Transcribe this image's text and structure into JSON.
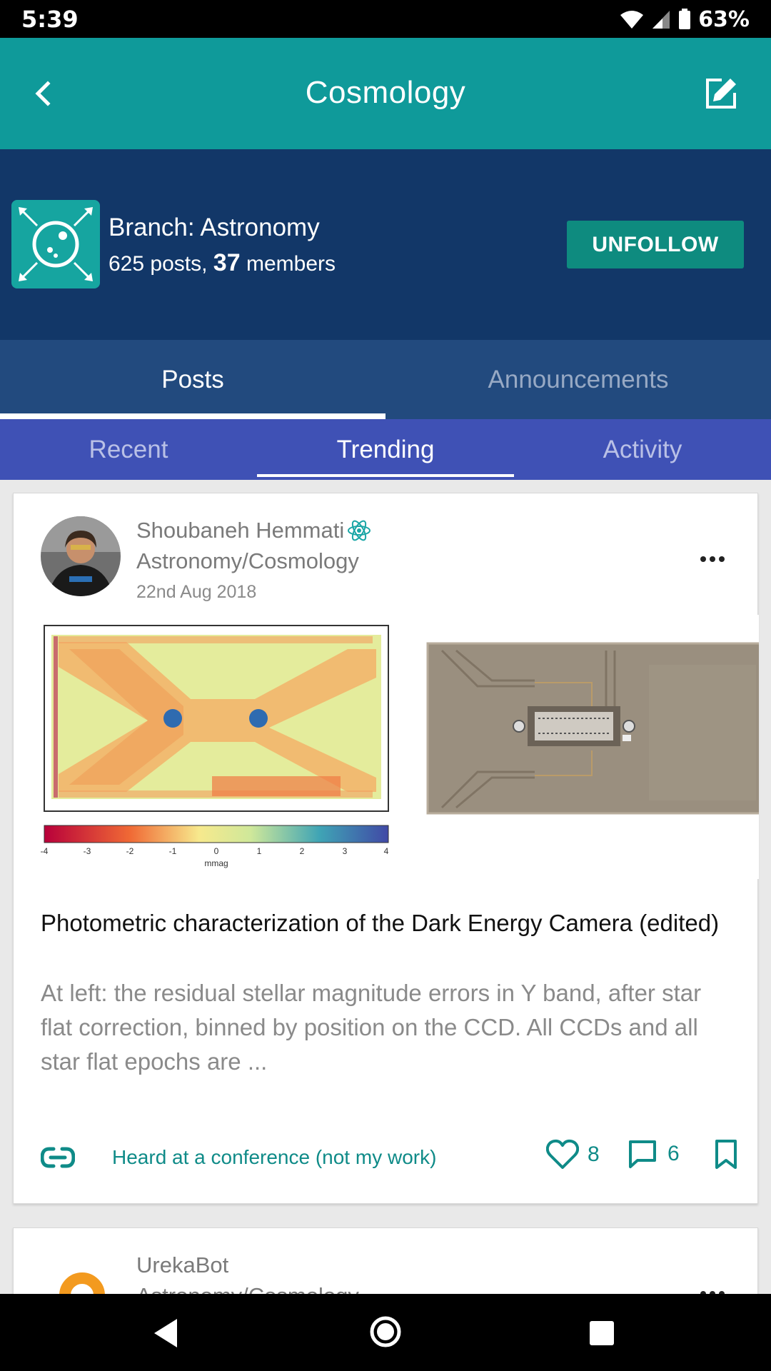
{
  "status_bar": {
    "time": "5:39",
    "battery": "63%"
  },
  "app_bar": {
    "title": "Cosmology"
  },
  "branch": {
    "name": "Branch: Astronomy",
    "posts_count": "625",
    "posts_label": "posts,",
    "members_count": "37",
    "members_label": "members",
    "unfollow_label": "UNFOLLOW",
    "icon_color": "#16a5a0"
  },
  "primary_tabs": [
    {
      "label": "Posts",
      "active": true
    },
    {
      "label": "Announcements",
      "active": false
    }
  ],
  "secondary_tabs": [
    {
      "label": "Recent",
      "active": false
    },
    {
      "label": "Trending",
      "active": true
    },
    {
      "label": "Activity",
      "active": false
    }
  ],
  "posts": [
    {
      "author": "Shoubaneh Hemmati",
      "branch_path": "Astronomy/Cosmology",
      "date": "22nd Aug 2018",
      "title": "Photometric characterization of the Dark Energy Camera (edited)",
      "excerpt": "At left: the residual stellar magnitude errors in Y band, after star flat correction, binned by position on the CCD. All CCDs and all star flat epochs are ...",
      "colorbar_ticks": [
        "-4",
        "-3",
        "-2",
        "-1",
        "0",
        "1",
        "2",
        "3",
        "4"
      ],
      "colorbar_label": "mmag",
      "source_label": "Heard at a conference (not my work)",
      "likes": "8",
      "comments": "6"
    },
    {
      "author": "UrekaBot",
      "branch_path": "Astronomy/Cosmology"
    }
  ],
  "colors": {
    "app_bar": "#0f9a9a",
    "branch_header": "#123768",
    "primary_tabs": "#224a7e",
    "secondary_tabs": "#3f51b5",
    "accent": "#0f8b88",
    "unfollow": "#0e8b7f"
  },
  "icons": [
    "back-arrow-icon",
    "edit-icon",
    "planet-icon",
    "atom-icon",
    "more-icon",
    "link-icon",
    "heart-icon",
    "comment-icon",
    "bookmark-icon",
    "nav-back-icon",
    "nav-home-icon",
    "nav-recent-icon"
  ]
}
